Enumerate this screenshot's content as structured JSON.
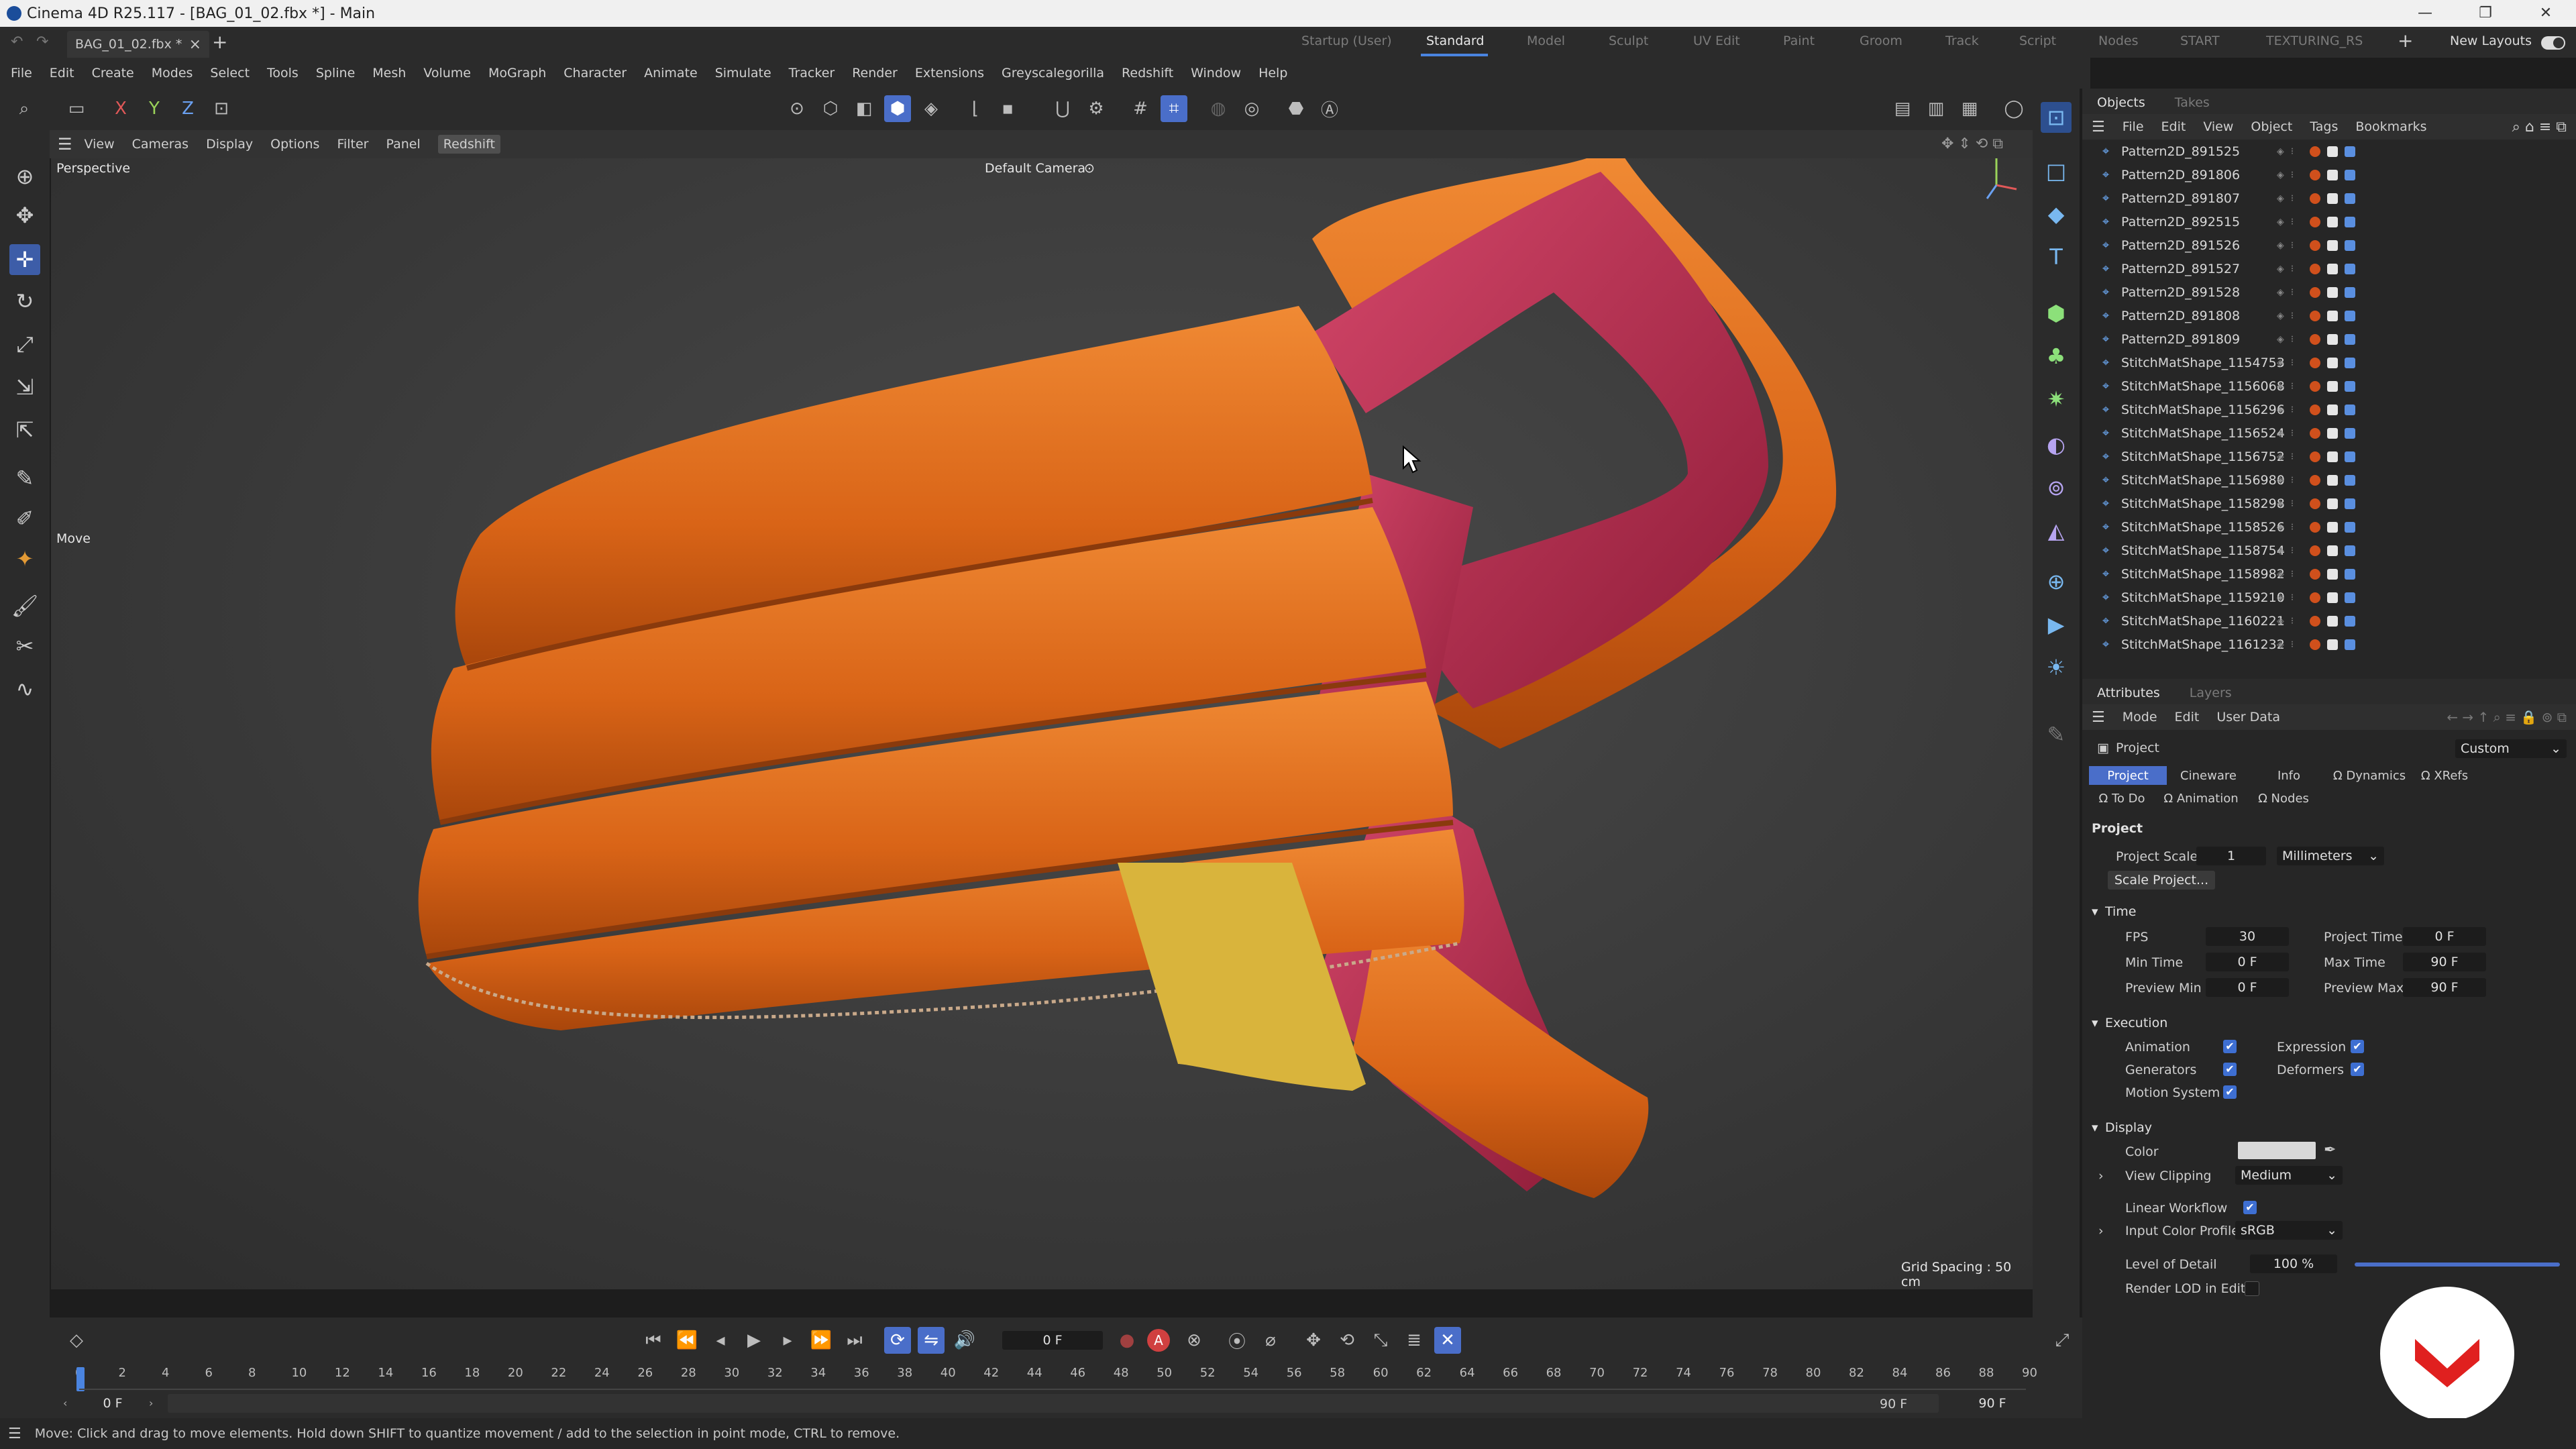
{
  "window": {
    "title": "Cinema 4D R25.117 - [BAG_01_02.fbx *] - Main",
    "controls": [
      "—",
      "❐",
      "✕"
    ]
  },
  "doc_tab": {
    "name": "BAG_01_02.fbx *",
    "close": "×",
    "add": "+"
  },
  "layouts": {
    "tabs": [
      "Startup (User)",
      "Standard",
      "Model",
      "Sculpt",
      "UV Edit",
      "Paint",
      "Groom",
      "Track",
      "Script",
      "Nodes",
      "START",
      "TEXTURING_RS"
    ],
    "active": "Standard",
    "new_layouts": "New Layouts"
  },
  "menubar": [
    "File",
    "Edit",
    "Create",
    "Modes",
    "Select",
    "Tools",
    "Spline",
    "Mesh",
    "Volume",
    "MoGraph",
    "Character",
    "Animate",
    "Simulate",
    "Tracker",
    "Render",
    "Extensions",
    "Greyscalegorilla",
    "Redshift",
    "Window",
    "Help"
  ],
  "axis_toggles": [
    "X",
    "Y",
    "Z"
  ],
  "viewport": {
    "menu": [
      "View",
      "Cameras",
      "Display",
      "Options",
      "Filter",
      "Panel",
      "Redshift"
    ],
    "active_menu": "Redshift",
    "view_name": "Perspective",
    "camera": "Default Camera",
    "camera_icon": "⊙",
    "tool_label": "Move",
    "grid_spacing": "Grid Spacing : 50 cm",
    "colors": {
      "orange": "#e06a1c",
      "pink": "#c2304f",
      "yellow": "#d9b43c"
    }
  },
  "objects_panel": {
    "tabs": [
      "Objects",
      "Takes"
    ],
    "menu": [
      "File",
      "Edit",
      "View",
      "Object",
      "Tags",
      "Bookmarks"
    ],
    "items": [
      "Pattern2D_891525",
      "Pattern2D_891806",
      "Pattern2D_891807",
      "Pattern2D_892515",
      "Pattern2D_891526",
      "Pattern2D_891527",
      "Pattern2D_891528",
      "Pattern2D_891808",
      "Pattern2D_891809",
      "StitchMatShape_1154753",
      "StitchMatShape_1156068",
      "StitchMatShape_1156296",
      "StitchMatShape_1156524",
      "StitchMatShape_1156752",
      "StitchMatShape_1156980",
      "StitchMatShape_1158298",
      "StitchMatShape_1158526",
      "StitchMatShape_1158754",
      "StitchMatShape_1158982",
      "StitchMatShape_1159210",
      "StitchMatShape_1160221",
      "StitchMatShape_1161232"
    ]
  },
  "attributes": {
    "tabs": [
      "Attributes",
      "Layers"
    ],
    "menu": [
      "Mode",
      "Edit",
      "User Data"
    ],
    "object_name": "Project",
    "preset": "Custom",
    "subtabs_row1": [
      "Project",
      "Cineware",
      "Info",
      "Ω Dynamics",
      "Ω XRefs"
    ],
    "subtabs_row2": [
      "Ω To Do",
      "Ω Animation",
      "Ω Nodes"
    ],
    "section": "Project",
    "project_scale_label": "Project Scale",
    "project_scale_value": "1",
    "project_scale_unit": "Millimeters",
    "scale_button": "Scale Project...",
    "time_head": "Time",
    "fps_label": "FPS",
    "fps": "30",
    "project_time_label": "Project Time",
    "project_time": "0 F",
    "min_time_label": "Min Time",
    "min_time": "0 F",
    "max_time_label": "Max Time",
    "max_time": "90 F",
    "preview_min_label": "Preview Min",
    "preview_min": "0 F",
    "preview_max_label": "Preview Max",
    "preview_max": "90 F",
    "execution_head": "Execution",
    "animation_label": "Animation",
    "expression_label": "Expression",
    "generators_label": "Generators",
    "deformers_label": "Deformers",
    "motion_label": "Motion System",
    "display_head": "Display",
    "color_label": "Color",
    "view_clipping_label": "View Clipping",
    "view_clipping": "Medium",
    "linear_label": "Linear Workflow",
    "icp_label": "Input Color Profile",
    "icp": "sRGB",
    "lod_label": "Level of Detail",
    "lod": "100 %",
    "lod_fraction": 1.0,
    "render_lod_label": "Render LOD in Editor",
    "checked_mark": "✔"
  },
  "timeline": {
    "current_frame": "0 F",
    "ticks": [
      "0",
      "2",
      "4",
      "6",
      "8",
      "10",
      "12",
      "14",
      "16",
      "18",
      "20",
      "22",
      "24",
      "26",
      "28",
      "30",
      "32",
      "34",
      "36",
      "38",
      "40",
      "42",
      "44",
      "46",
      "48",
      "50",
      "52",
      "54",
      "56",
      "58",
      "60",
      "62",
      "64",
      "66",
      "68",
      "70",
      "72",
      "74",
      "76",
      "78",
      "80",
      "82",
      "84",
      "86",
      "88",
      "90"
    ],
    "start": "0 F",
    "offset": "0 F",
    "end_a": "90 F",
    "end_b": "90 F",
    "rec_label": "A"
  },
  "status": "Move: Click and drag to move elements. Hold down SHIFT to quantize movement / add to the selection in point mode, CTRL to remove."
}
